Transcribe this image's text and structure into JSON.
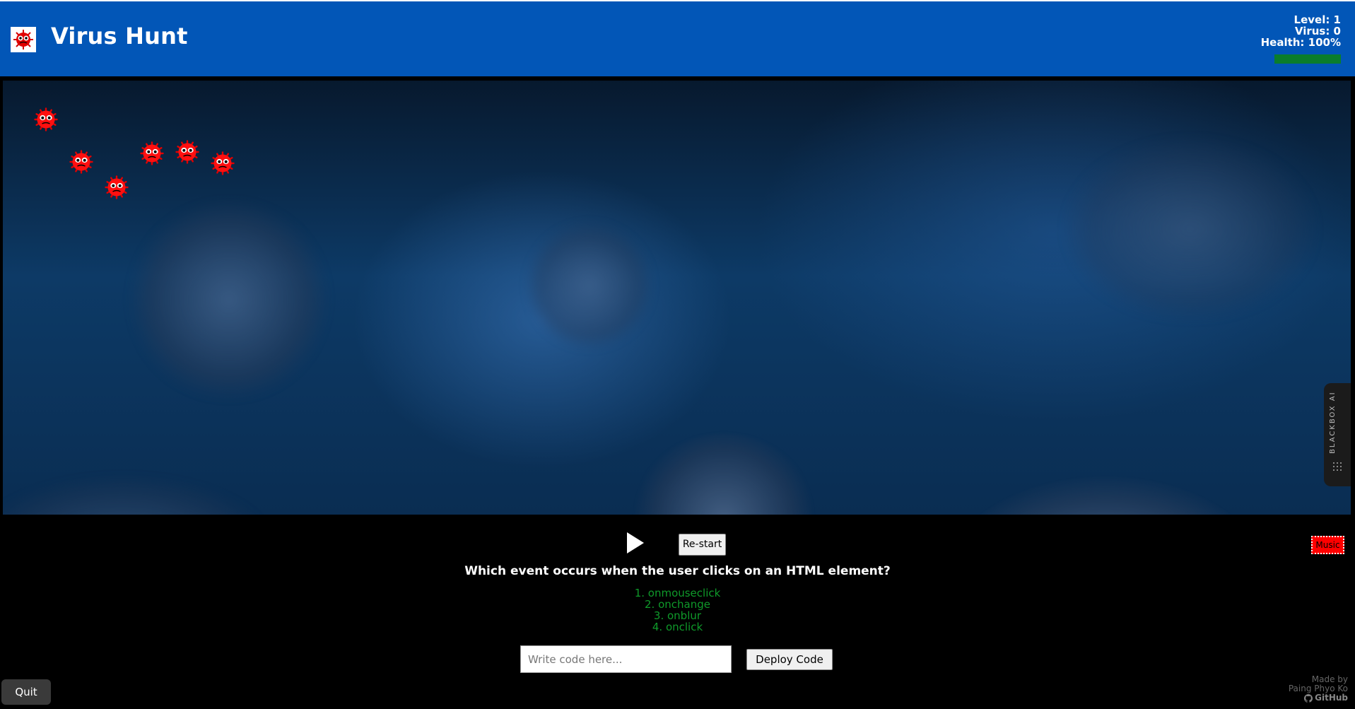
{
  "header": {
    "title": "Virus Hunt",
    "logo_icon": "virus-logo-icon",
    "stats": {
      "level": "Level: 1",
      "virus": "Virus: 0",
      "health": "Health: 100%"
    },
    "health_value": 1.0,
    "colors": {
      "bar": "#0256b7",
      "health": "#0a7d2c"
    }
  },
  "game": {
    "viruses": [
      {
        "icon": "virus-icon"
      },
      {
        "icon": "virus-icon"
      },
      {
        "icon": "virus-icon"
      },
      {
        "icon": "virus-icon"
      },
      {
        "icon": "virus-icon"
      },
      {
        "icon": "virus-icon"
      }
    ],
    "side_tab": {
      "label": "BLACKBOX AI"
    }
  },
  "controls": {
    "play_icon": "play-icon",
    "restart_label": "Re-start",
    "music_label": "Music",
    "question": "Which event occurs when the user clicks on an HTML element?",
    "options": [
      "1. onmouseclick",
      "2. onchange",
      "3. onblur",
      "4. onclick"
    ],
    "code_input": {
      "placeholder": "Write code here...",
      "value": ""
    },
    "deploy_label": "Deploy Code",
    "quit_label": "Quit",
    "option_color": "#0f9a2a",
    "music_color": "#ff0000"
  },
  "footer": {
    "credit_line1": "Made by",
    "credit_line2": "Paing Phyo Ko",
    "github_label": "GitHub",
    "github_icon": "github-icon"
  }
}
